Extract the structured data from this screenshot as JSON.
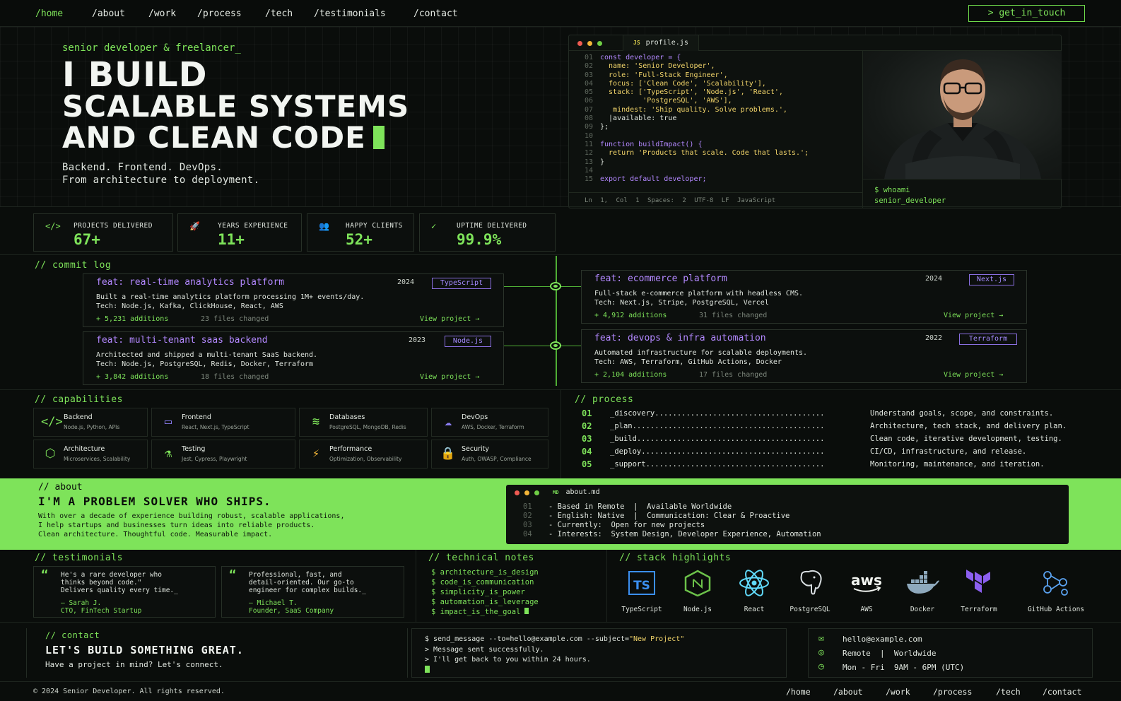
{
  "nav": {
    "items": [
      "/home",
      "/about",
      "/work",
      "/process",
      "/tech",
      "/testimonials",
      "/contact"
    ],
    "cta": "> get_in_touch"
  },
  "hero": {
    "eyebrow": "senior developer & freelancer_",
    "line1": "I BUILD",
    "line2": "SCALABLE SYSTEMS",
    "line3": "AND CLEAN CODE",
    "sub1": "Backend. Frontend. DevOps.",
    "sub2": "From architecture to deployment."
  },
  "code": {
    "tab_badge": "JS",
    "tab": "profile.js",
    "lines": [
      {
        "n": "01",
        "t": "const developer = {"
      },
      {
        "n": "02",
        "t": "  name: 'Senior Developer',"
      },
      {
        "n": "03",
        "t": "  role: 'Full-Stack Engineer',"
      },
      {
        "n": "04",
        "t": "  focus: ['Clean Code', 'Scalability'],"
      },
      {
        "n": "05",
        "t": "  stack: ['TypeScript', 'Node.js', 'React',"
      },
      {
        "n": "06",
        "t": "          'PostgreSQL', 'AWS'],"
      },
      {
        "n": "07",
        "t": "   mindest: 'Ship quality. Solve problems.',"
      },
      {
        "n": "08",
        "t": "  |available: true"
      },
      {
        "n": "09",
        "t": "};"
      },
      {
        "n": "10",
        "t": ""
      },
      {
        "n": "11",
        "t": "function buildImpact() {"
      },
      {
        "n": "12",
        "t": "  return 'Products that scale. Code that lasts.';"
      },
      {
        "n": "13",
        "t": "}"
      },
      {
        "n": "14",
        "t": ""
      },
      {
        "n": "15",
        "t": "export default developer;"
      }
    ],
    "status": "Ln 1, Col 1   Spaces: 2   UTF-8   LF   JavaScript",
    "whoami_cmd": "$ whoami",
    "whoami_out": "senior_developer"
  },
  "stats": [
    {
      "icon": "</>",
      "label": "PROJECTS DELIVERED",
      "value": "67+"
    },
    {
      "icon": "🚀",
      "label": "YEARS EXPERIENCE",
      "value": "11+"
    },
    {
      "icon": "👥",
      "label": "HAPPY CLIENTS",
      "value": "52+"
    },
    {
      "icon": "✓",
      "label": "UPTIME DELIVERED",
      "value": "99.9%"
    }
  ],
  "commit_log": {
    "title": "// commit log",
    "items": [
      {
        "title": "feat: real-time analytics platform",
        "year": "2024",
        "tag": "TypeScript",
        "desc": "Built a real-time analytics platform processing 1M+ events/day.",
        "tech": "Tech: Node.js, Kafka, ClickHouse, React, AWS",
        "adds": "+ 5,231 additions",
        "files": "23 files changed",
        "link": "View project →"
      },
      {
        "title": "feat: ecommerce platform",
        "year": "2024",
        "tag": "Next.js",
        "desc": "Full-stack e-commerce platform with headless CMS.",
        "tech": "Tech: Next.js, Stripe, PostgreSQL, Vercel",
        "adds": "+ 4,912 additions",
        "files": "31 files changed",
        "link": "View project →"
      },
      {
        "title": "feat: multi-tenant saas backend",
        "year": "2023",
        "tag": "Node.js",
        "desc": "Architected and shipped a multi-tenant SaaS backend.",
        "tech": "Tech: Node.js, PostgreSQL, Redis, Docker, Terraform",
        "adds": "+ 3,842 additions",
        "files": "18 files changed",
        "link": "View project →"
      },
      {
        "title": "feat: devops & infra automation",
        "year": "2022",
        "tag": "Terraform",
        "desc": "Automated infrastructure for scalable deployments.",
        "tech": "Tech: AWS, Terraform, GitHub Actions, Docker",
        "adds": "+ 2,104 additions",
        "files": "17 files changed",
        "link": "View project →"
      }
    ]
  },
  "capabilities": {
    "title": "// capabilities",
    "items": [
      {
        "icon": "</>",
        "name": "Backend",
        "sub": "Node.js, Python, APIs"
      },
      {
        "icon": "▭",
        "name": "Frontend",
        "sub": "React, Next.js, TypeScript"
      },
      {
        "icon": "≋",
        "name": "Databases",
        "sub": "PostgreSQL, MongoDB, Redis"
      },
      {
        "icon": "☁",
        "name": "DevOps",
        "sub": "AWS, Docker, Terraform"
      },
      {
        "icon": "⬡",
        "name": "Architecture",
        "sub": "Microservices, Scalability"
      },
      {
        "icon": "⚗",
        "name": "Testing",
        "sub": "Jest, Cypress, Playwright"
      },
      {
        "icon": "⚡",
        "name": "Performance",
        "sub": "Optimization, Observability"
      },
      {
        "icon": "🔒",
        "name": "Security",
        "sub": "Auth, OWASP, Compliance"
      }
    ]
  },
  "process": {
    "title": "// process",
    "items": [
      {
        "n": "01",
        "k": "_discovery......................................",
        "d": "Understand goals, scope, and constraints."
      },
      {
        "n": "02",
        "k": "_plan...........................................",
        "d": "Architecture, tech stack, and delivery plan."
      },
      {
        "n": "03",
        "k": "_build..........................................",
        "d": "Clean code, iterative development, testing."
      },
      {
        "n": "04",
        "k": "_deploy.........................................",
        "d": "CI/CD, infrastructure, and release."
      },
      {
        "n": "05",
        "k": "_support........................................",
        "d": "Monitoring, maintenance, and iteration."
      }
    ]
  },
  "about": {
    "title": "// about",
    "heading": "I'M A PROBLEM SOLVER WHO SHIPS.",
    "p1": "With over a decade of experience building robust, scalable applications,",
    "p2": "I help startups and businesses turn ideas into reliable products.",
    "p3": "Clean architecture. Thoughtful code. Measurable impact.",
    "md_badge": "MD",
    "md_tab": "about.md",
    "md_lines": [
      {
        "n": "01",
        "t": "- Based in Remote  |  Available Worldwide"
      },
      {
        "n": "02",
        "t": "- English: Native  |  Communication: Clear & Proactive"
      },
      {
        "n": "03",
        "t": "- Currently:  Open for new projects"
      },
      {
        "n": "04",
        "t": "- Interests:  System Design, Developer Experience, Automation"
      }
    ]
  },
  "testimonials": {
    "title": "// testimonials",
    "items": [
      {
        "q1": "He's a rare developer who",
        "q2": "thinks beyond code.\"",
        "q3": "Delivers quality every time._",
        "author": "— Sarah J.",
        "role": "CTO, FinTech Startup"
      },
      {
        "q1": "Professional, fast, and",
        "q2": "detail-oriented. Our go-to",
        "q3": "engineer for complex builds._",
        "author": "— Michael T.",
        "role": "Founder, SaaS Company"
      }
    ]
  },
  "notes": {
    "title": "// technical notes",
    "items": [
      "architecture_is_design",
      "code_is_communication",
      "simplicity_is_power",
      "automation_is_leverage",
      "impact_is_the_goal"
    ]
  },
  "stack": {
    "title": "// stack highlights",
    "items": [
      "TypeScript",
      "Node.js",
      "React",
      "PostgreSQL",
      "AWS",
      "Docker",
      "Terraform",
      "GitHub Actions"
    ],
    "aws_logo": "aws",
    "ts_logo": "TS"
  },
  "contact": {
    "title": "// contact",
    "heading": "LET'S BUILD SOMETHING GREAT.",
    "sub": "Have a project in mind? Let's connect.",
    "cmd1": "$ send_message --to=hello@example.com --subject=",
    "cmd1b": "\"New Project\"",
    "cmd2": "> Message sent successfully.",
    "cmd3": "> I'll get back to you within 24 hours.",
    "email": "hello@example.com",
    "location": "Remote  |  Worldwide",
    "hours": "Mon - Fri  9AM - 6PM (UTC)"
  },
  "footer": {
    "copyright": "© 2024 Senior Developer. All rights reserved.",
    "links": [
      "/home",
      "/about",
      "/work",
      "/process",
      "/tech",
      "/contact"
    ]
  },
  "colors": {
    "accent": "#7ee35a",
    "bg": "#0a0d0b",
    "purple": "#b388ff"
  }
}
